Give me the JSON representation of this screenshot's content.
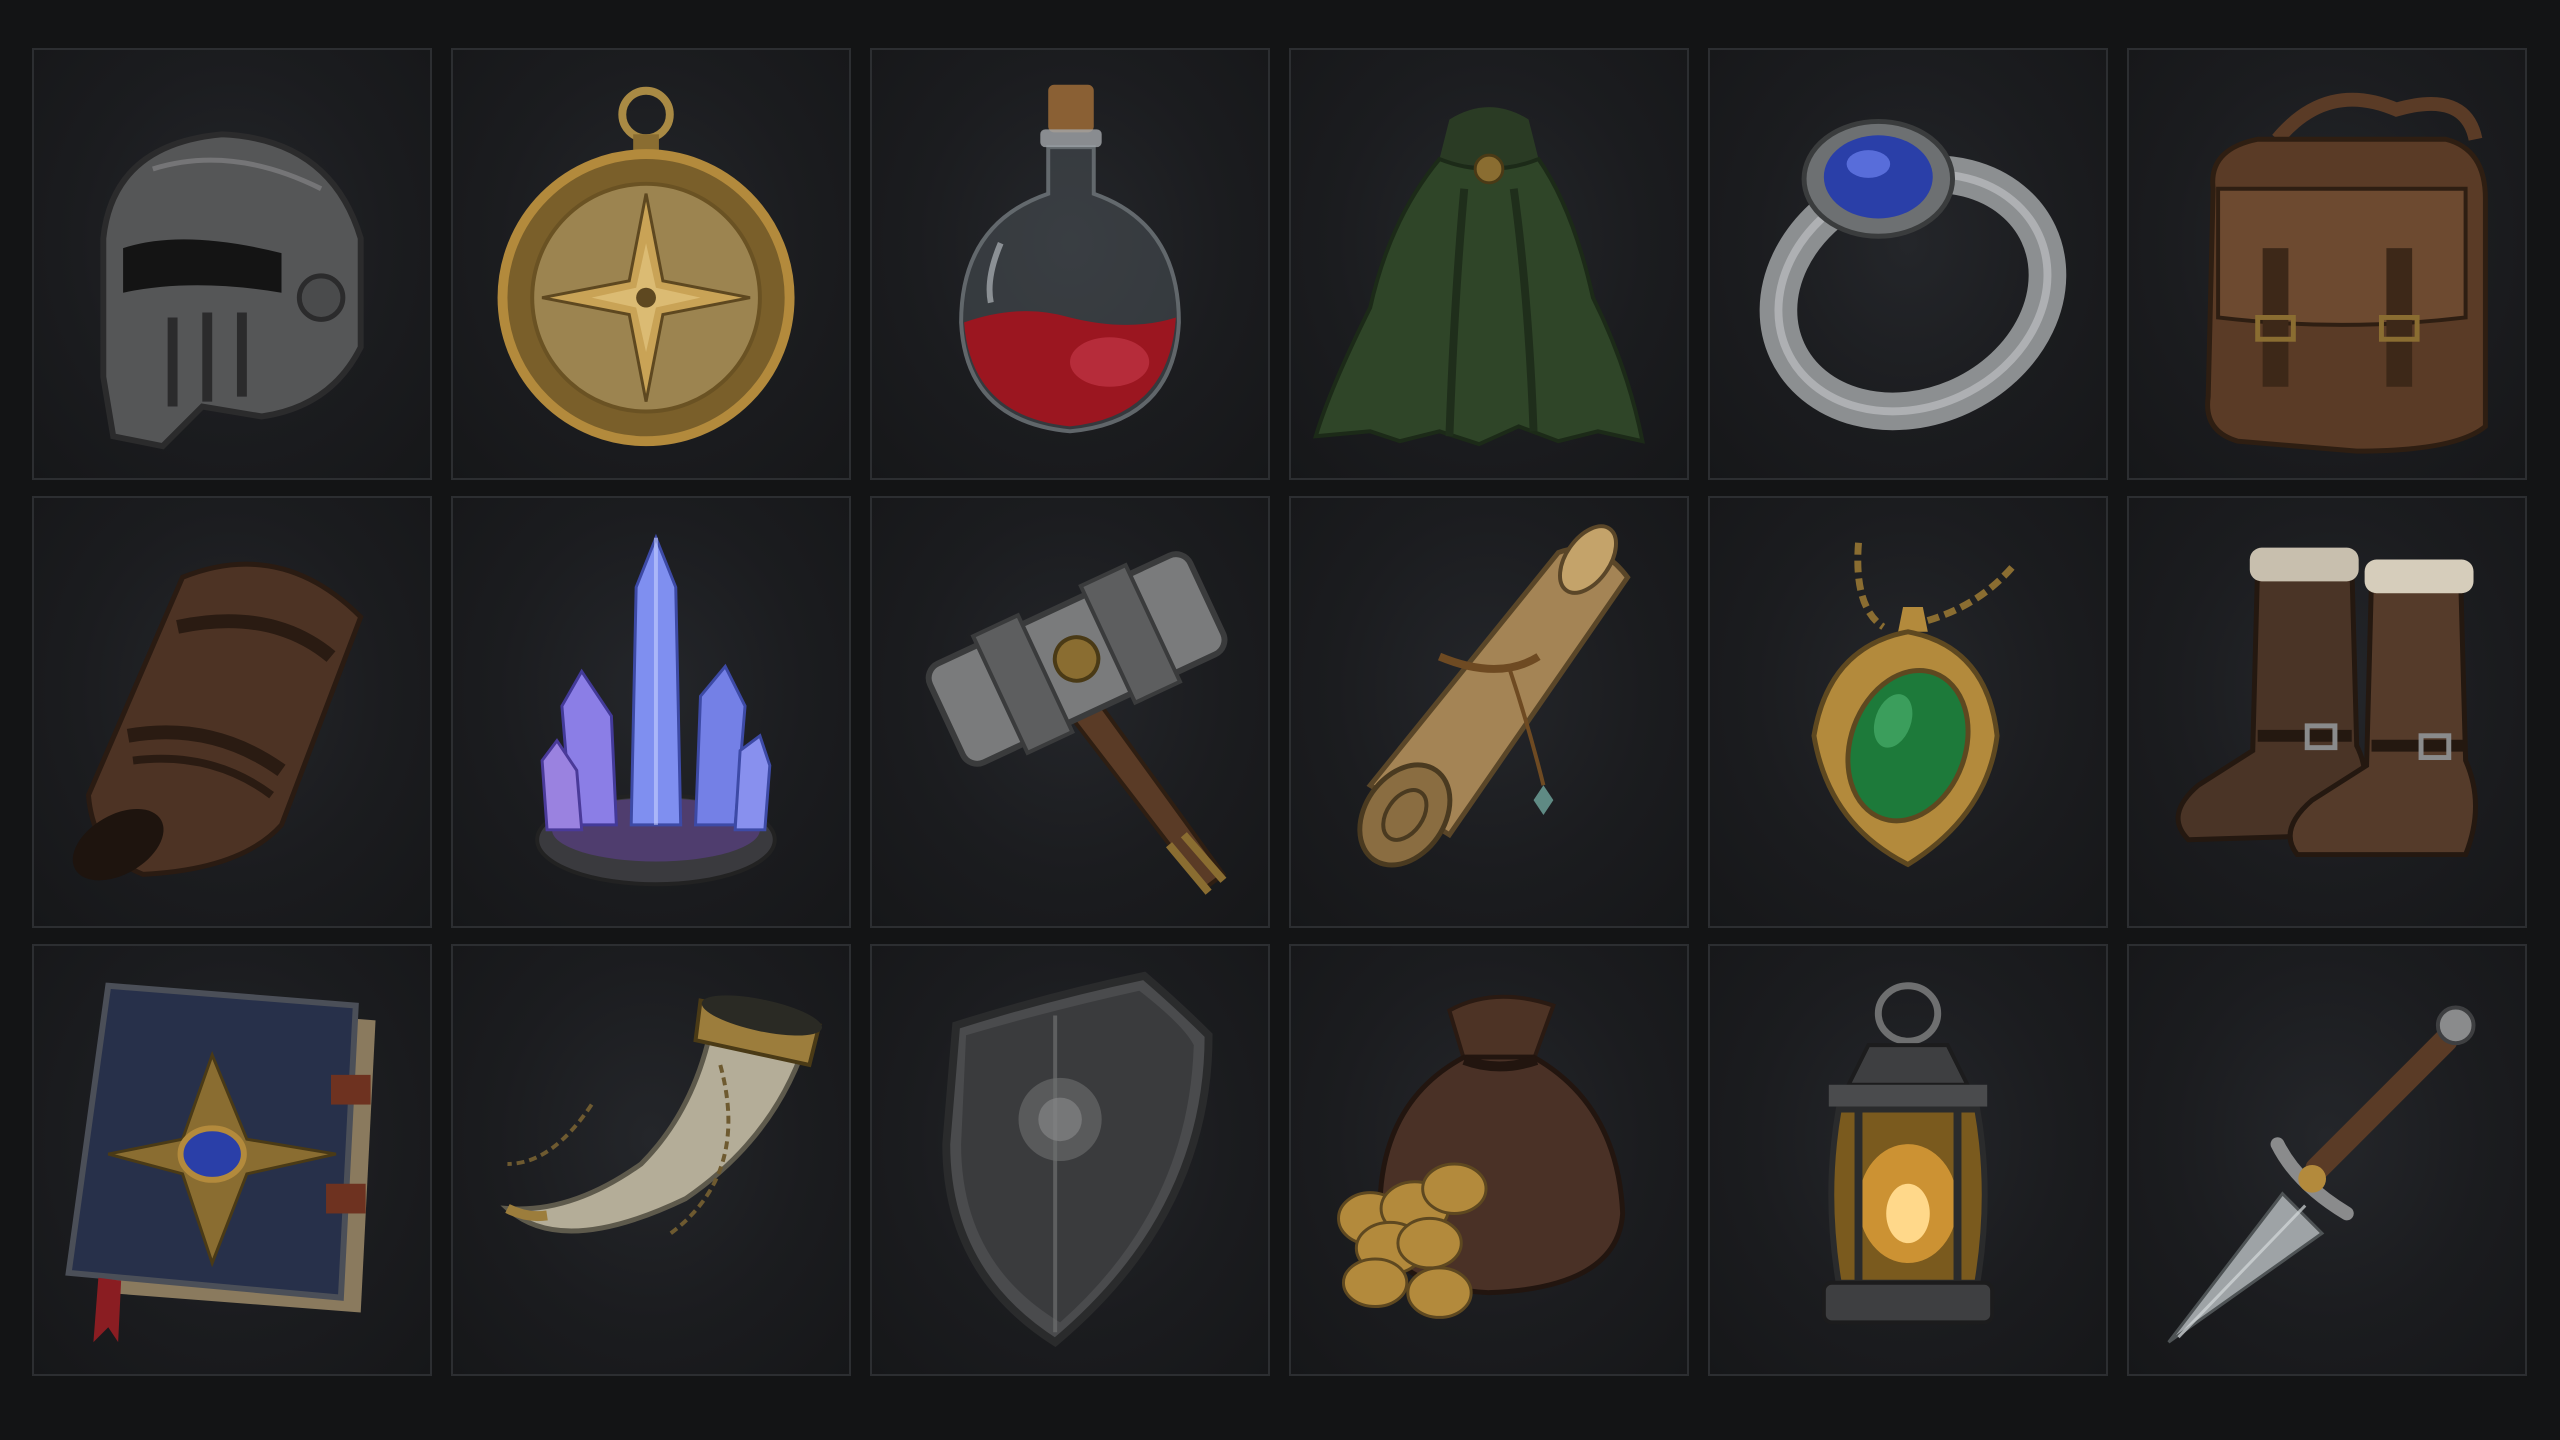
{
  "inventory": {
    "columns": 6,
    "rows": 3,
    "slots": [
      {
        "icon": "helmet-icon"
      },
      {
        "icon": "compass-icon"
      },
      {
        "icon": "red-potion-flask-icon"
      },
      {
        "icon": "green-cloak-icon"
      },
      {
        "icon": "sapphire-ring-icon"
      },
      {
        "icon": "leather-backpack-icon"
      },
      {
        "icon": "leather-bracer-icon"
      },
      {
        "icon": "blue-crystal-cluster-icon"
      },
      {
        "icon": "war-hammer-icon"
      },
      {
        "icon": "parchment-scroll-icon"
      },
      {
        "icon": "emerald-amulet-icon"
      },
      {
        "icon": "leather-boots-icon"
      },
      {
        "icon": "spellbook-icon"
      },
      {
        "icon": "drinking-horn-icon"
      },
      {
        "icon": "iron-shield-icon"
      },
      {
        "icon": "coin-pouch-icon"
      },
      {
        "icon": "lantern-icon"
      },
      {
        "icon": "dagger-icon"
      }
    ]
  },
  "colors": {
    "background": "#131415",
    "slot_fill": "#1b1c1f",
    "slot_border": "#2c2e31",
    "iron": "#6e6f70",
    "gold": "#b38a3c",
    "leather": "#5a3b26",
    "potion_red": "#9b1620",
    "cloak_green": "#2f4528",
    "sapphire": "#2a3fa8",
    "emerald": "#1d7a3a",
    "crystal": "#7f8ff0"
  }
}
